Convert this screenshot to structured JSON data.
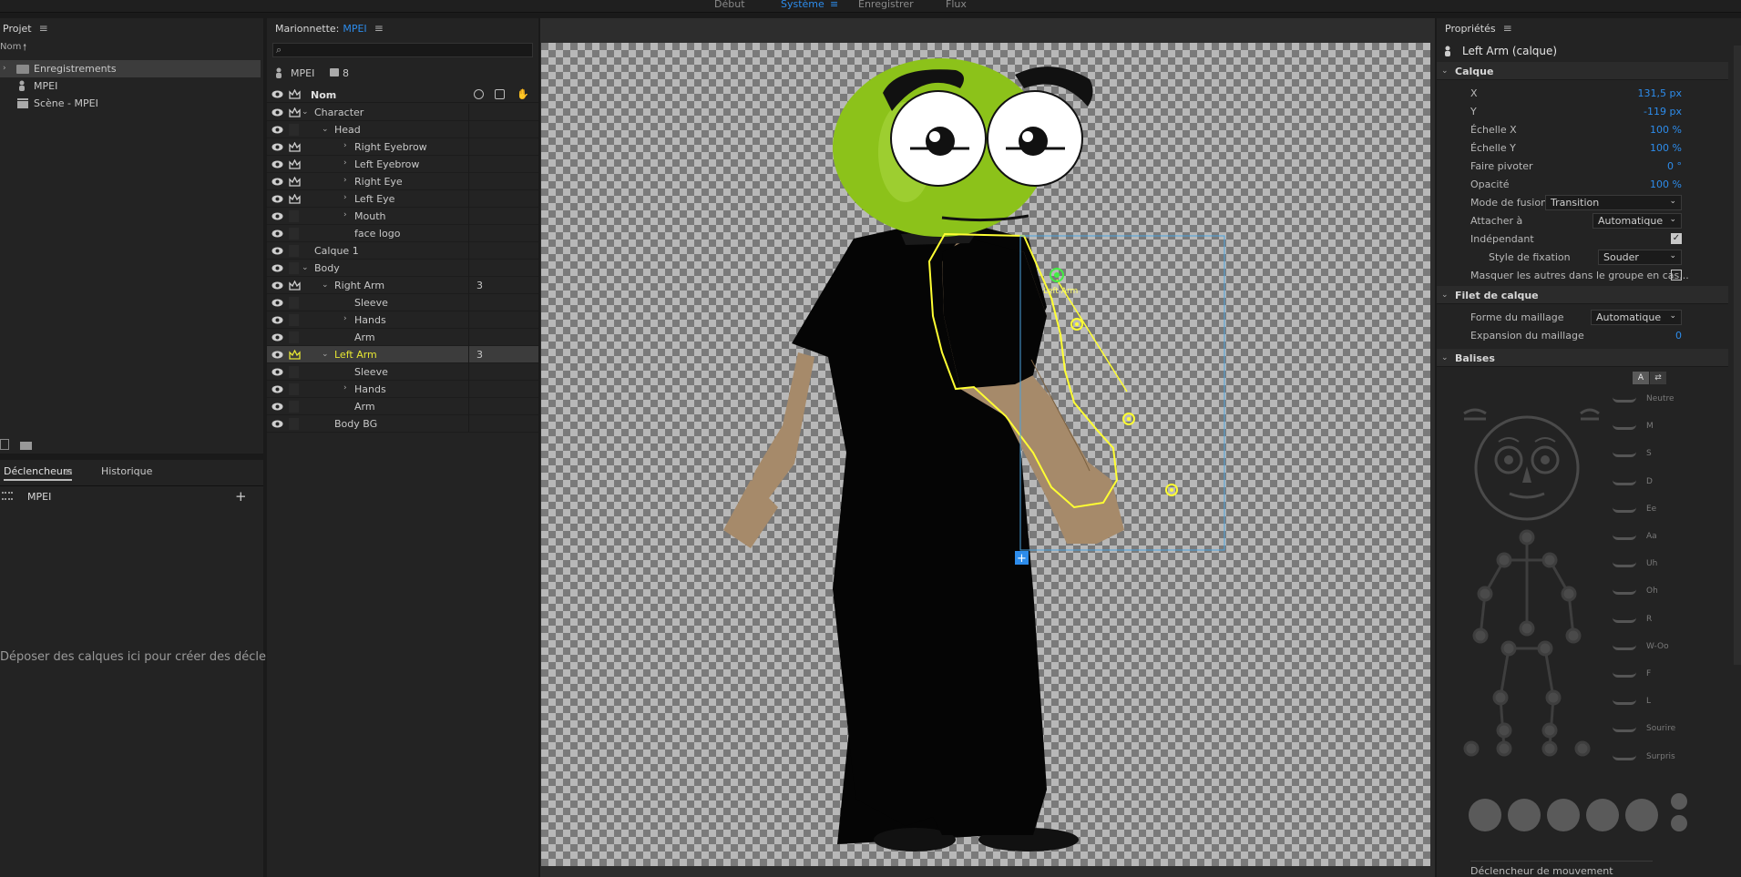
{
  "workspace_tabs": [
    {
      "label": "Début",
      "active": false
    },
    {
      "label": "Système",
      "active": true
    },
    {
      "label": "Enregistrer",
      "active": false
    },
    {
      "label": "Flux",
      "active": false
    }
  ],
  "project": {
    "title": "Projet",
    "sort_label": "Nom",
    "items": [
      {
        "label": "Enregistrements",
        "icon": "folder-icon",
        "selected": true
      },
      {
        "label": "MPEI",
        "icon": "puppet-icon",
        "selected": false
      },
      {
        "label": "Scène - MPEI",
        "icon": "scene-icon",
        "selected": false
      }
    ]
  },
  "triggers": {
    "tab_active": "Déclencheurs",
    "tab_other": "Historique",
    "puppet": "MPEI",
    "add": "+",
    "empty_text": "Déposer des calques ici pour créer des déclenche..."
  },
  "puppet_panel": {
    "title_prefix": "Marionnette:",
    "title_name": "MPEI",
    "puppet_name": "MPEI",
    "recorded_count": "8",
    "col_name": "Nom",
    "layers": [
      {
        "label": "Character",
        "depth": 0,
        "expand": "open",
        "crown": true
      },
      {
        "label": "Head",
        "depth": 1,
        "expand": "open",
        "crown": false
      },
      {
        "label": "Right Eyebrow",
        "depth": 2,
        "expand": "closed",
        "crown": true
      },
      {
        "label": "Left Eyebrow",
        "depth": 2,
        "expand": "closed",
        "crown": true
      },
      {
        "label": "Right Eye",
        "depth": 2,
        "expand": "closed",
        "crown": true
      },
      {
        "label": "Left Eye",
        "depth": 2,
        "expand": "closed",
        "crown": true
      },
      {
        "label": "Mouth",
        "depth": 2,
        "expand": "closed",
        "crown": false
      },
      {
        "label": "face logo",
        "depth": 2,
        "expand": "none",
        "crown": false
      },
      {
        "label": "Calque 1",
        "depth": 0,
        "expand": "none",
        "crown": false
      },
      {
        "label": "Body",
        "depth": 0,
        "expand": "open",
        "crown": false
      },
      {
        "label": "Right Arm",
        "depth": 1,
        "expand": "open",
        "crown": true,
        "count": "3"
      },
      {
        "label": "Sleeve",
        "depth": 2,
        "expand": "none",
        "crown": false
      },
      {
        "label": "Hands",
        "depth": 2,
        "expand": "closed",
        "crown": false
      },
      {
        "label": "Arm",
        "depth": 2,
        "expand": "none",
        "crown": false
      },
      {
        "label": "Left Arm",
        "depth": 1,
        "expand": "open",
        "crown": true,
        "count": "3",
        "selected": true
      },
      {
        "label": "Sleeve",
        "depth": 2,
        "expand": "none",
        "crown": false
      },
      {
        "label": "Hands",
        "depth": 2,
        "expand": "closed",
        "crown": false
      },
      {
        "label": "Arm",
        "depth": 2,
        "expand": "none",
        "crown": false
      },
      {
        "label": "Body BG",
        "depth": 1,
        "expand": "none",
        "crown": false
      }
    ]
  },
  "canvas": {
    "handle_label": "Left Arm",
    "selection_color": "#ffff33",
    "bounds_color": "#4aa3df",
    "head_color": "#8cc21a"
  },
  "properties": {
    "title": "Propriétés",
    "layer_title": "Left Arm (calque)",
    "section_layer": "Calque",
    "fields": [
      {
        "label": "X",
        "value": "131,5 px"
      },
      {
        "label": "Y",
        "value": "-119 px"
      },
      {
        "label": "Échelle X",
        "value": "100 %"
      },
      {
        "label": "Échelle Y",
        "value": "100 %"
      },
      {
        "label": "Faire pivoter",
        "value": "0 °"
      },
      {
        "label": "Opacité",
        "value": "100 %"
      }
    ],
    "blend_label": "Mode de fusion",
    "blend_value": "Transition",
    "attach_label": "Attacher à",
    "attach_value": "Automatique",
    "independent_label": "Indépendant",
    "independent_checked": true,
    "fix_style_label": "Style de fixation",
    "fix_style_value": "Souder",
    "hide_others_label": "Masquer les autres dans le groupe en cas...",
    "hide_others_checked": false,
    "section_mesh": "Filet de calque",
    "mesh_shape_label": "Forme du maillage",
    "mesh_shape_value": "Automatique",
    "mesh_expand_label": "Expansion du maillage",
    "mesh_expand_value": "0",
    "section_tags": "Balises",
    "tag_toggle_a": "A",
    "visemes": [
      "Neutre",
      "M",
      "S",
      "D",
      "Ee",
      "Aa",
      "Uh",
      "Oh",
      "R",
      "W-Oo",
      "F",
      "L",
      "Sourire",
      "Surpris"
    ],
    "motion_trigger_label": "Déclencheur de mouvement"
  }
}
